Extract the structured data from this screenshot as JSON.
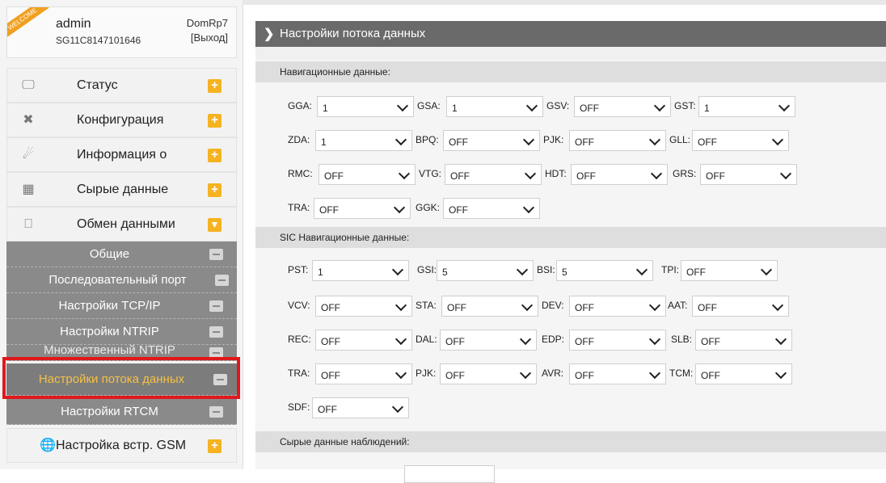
{
  "user": {
    "badge": "WELCOME",
    "name": "admin",
    "serial": "SG11C8147101646",
    "device": "DomRp7",
    "logout": "[Выход]"
  },
  "menu": {
    "status": "Статус",
    "config": "Конфигурация",
    "info": "Информация о",
    "raw": "Сырые данные",
    "exchange": "Обмен данными",
    "gsm": "Настройка встр. GSM"
  },
  "submenu": {
    "general": "Общие",
    "serial": "Последовательный порт",
    "tcpip": "Настройки TCP/IP",
    "ntrip": "Настройки NTRIP",
    "multi_ntrip": "Множественный NTRIP",
    "stream": "Настройки потока данных",
    "rtcm": "Настройки RTCM"
  },
  "page": {
    "title": "Настройки потока данных"
  },
  "sections": {
    "nav": "Навигационные данные:",
    "sic": "SIC Навигационные данные:",
    "raw": "Сырые данные наблюдений:"
  },
  "nav_fields": {
    "GGA": {
      "label": "GGA:",
      "value": "1"
    },
    "GSA": {
      "label": "GSA:",
      "value": "1"
    },
    "GSV": {
      "label": "GSV:",
      "value": "OFF"
    },
    "GST": {
      "label": "GST:",
      "value": "1"
    },
    "ZDA": {
      "label": "ZDA:",
      "value": "1"
    },
    "BPQ": {
      "label": "BPQ:",
      "value": "OFF"
    },
    "PJK": {
      "label": "PJK:",
      "value": "OFF"
    },
    "GLL": {
      "label": "GLL:",
      "value": "OFF"
    },
    "RMC": {
      "label": "RMC:",
      "value": "OFF"
    },
    "VTG": {
      "label": "VTG:",
      "value": "OFF"
    },
    "HDT": {
      "label": "HDT:",
      "value": "OFF"
    },
    "GRS": {
      "label": "GRS:",
      "value": "OFF"
    },
    "TRA": {
      "label": "TRA:",
      "value": "OFF"
    },
    "GGK": {
      "label": "GGK:",
      "value": "OFF"
    }
  },
  "sic_fields": {
    "PST": {
      "label": "PST:",
      "value": "1"
    },
    "GSI": {
      "label": "GSI:",
      "value": "5"
    },
    "BSI": {
      "label": "BSI:",
      "value": "5"
    },
    "TPI": {
      "label": "TPI:",
      "value": "OFF"
    },
    "VCV": {
      "label": "VCV:",
      "value": "OFF"
    },
    "STA": {
      "label": "STA:",
      "value": "OFF"
    },
    "DEV": {
      "label": "DEV:",
      "value": "OFF"
    },
    "AAT": {
      "label": "AAT:",
      "value": "OFF"
    },
    "REC": {
      "label": "REC:",
      "value": "OFF"
    },
    "DAL": {
      "label": "DAL:",
      "value": "OFF"
    },
    "EDP": {
      "label": "EDP:",
      "value": "OFF"
    },
    "SLB": {
      "label": "SLB:",
      "value": "OFF"
    },
    "TRA": {
      "label": "TRA:",
      "value": "OFF"
    },
    "PJK": {
      "label": "PJK:",
      "value": "OFF"
    },
    "AVR": {
      "label": "AVR:",
      "value": "OFF"
    },
    "TCM": {
      "label": "TCM:",
      "value": "OFF"
    },
    "SDF": {
      "label": "SDF:",
      "value": "OFF"
    }
  },
  "colors": {
    "accent": "#f5b322",
    "highlight": "#e0181c",
    "submenu_bg": "#8a8a8a",
    "active_text": "#f5c046"
  }
}
